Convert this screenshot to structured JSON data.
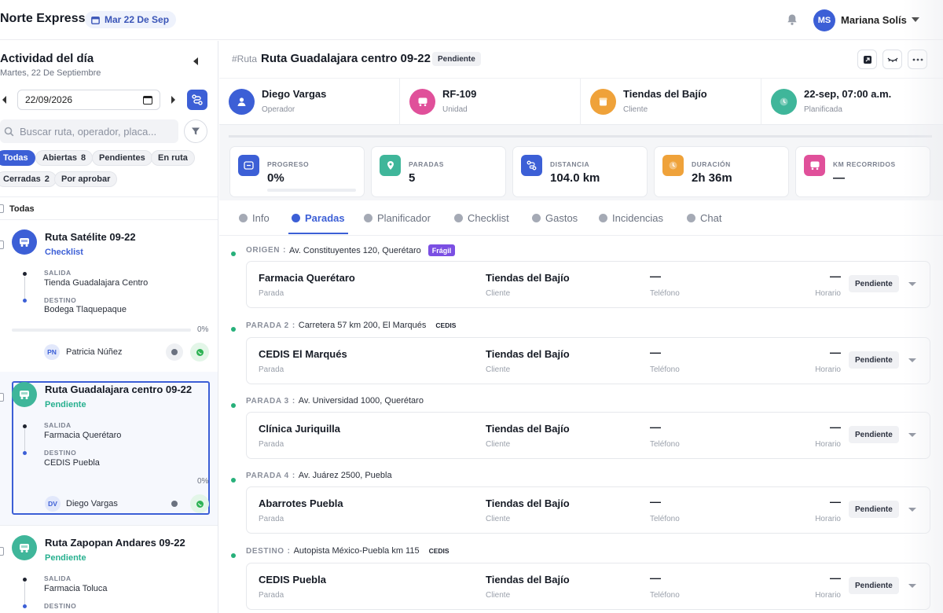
{
  "app": {
    "brand": "Norte Express",
    "date_chip": "Mar 22 De Sep"
  },
  "user": {
    "initials": "MS",
    "name": "Mariana Solís"
  },
  "sidebar": {
    "title": "Actividad del día",
    "subtitle": "Martes, 22 De Septiembre",
    "date_value": "22/09/2026",
    "search_placeholder": "Buscar ruta, operador, placa...",
    "filters": [
      {
        "label": "Todas",
        "count": ""
      },
      {
        "label": "Abiertas",
        "count": "8"
      },
      {
        "label": "Pendientes",
        "count": ""
      },
      {
        "label": "En ruta",
        "count": ""
      },
      {
        "label": "Cerradas",
        "count": "2"
      },
      {
        "label": "Por aprobar",
        "count": ""
      }
    ],
    "select_all_label": "Todas",
    "routes": [
      {
        "name": "Ruta Satélite 09-22",
        "status": "Checklist",
        "status_color": "#3c5fd6",
        "icon_color": "#3c5fd6",
        "salida_label": "SALIDA",
        "salida": "Tienda Guadalajara Centro",
        "destino_label": "DESTINO",
        "destino": "Bodega Tlaquepaque",
        "progress": "0%",
        "operator_initials": "PN",
        "operator": "Patricia Núñez"
      },
      {
        "name": "Ruta Guadalajara centro 09-22",
        "status": "Pendiente",
        "status_color": "#27b08f",
        "icon_color": "#3fb69a",
        "salida_label": "SALIDA",
        "salida": "Farmacia Querétaro",
        "destino_label": "DESTINO",
        "destino": "CEDIS Puebla",
        "progress": "0%",
        "operator_initials": "DV",
        "operator": "Diego Vargas"
      },
      {
        "name": "Ruta Zapopan Andares 09-22",
        "status": "Pendiente",
        "status_color": "#27b08f",
        "icon_color": "#3fb69a",
        "salida_label": "SALIDA",
        "salida": "Farmacia Toluca",
        "destino_label": "DESTINO"
      }
    ]
  },
  "main": {
    "hash": "#Ruta",
    "route_name": "Ruta Guadalajara centro 09-22",
    "route_status": "Pendiente",
    "info": [
      {
        "value": "Diego Vargas",
        "label": "Operador",
        "color": "#3c5fd6"
      },
      {
        "value": "RF-109",
        "label": "Unidad",
        "color": "#e0509a"
      },
      {
        "value": "Tiendas del Bajío",
        "label": "Cliente",
        "color": "#efa23a"
      },
      {
        "value": "22-sep, 07:00 a.m.",
        "label": "Planificada",
        "color": "#3fb69a"
      }
    ],
    "stats": [
      {
        "label": "PROGRESO",
        "value": "0%",
        "color": "#3c5fd6",
        "progress": 0
      },
      {
        "label": "PARADAS",
        "value": "5",
        "color": "#3fb69a"
      },
      {
        "label": "DISTANCIA",
        "value": "104.0 km",
        "color": "#3c5fd6"
      },
      {
        "label": "DURACIÓN",
        "value": "2h 36m",
        "color": "#efa23a"
      },
      {
        "label": "KM RECORRIDOS",
        "value": "—",
        "color": "#e0509a"
      }
    ],
    "tabs": [
      "Info",
      "Paradas",
      "Planificador",
      "Checklist",
      "Gastos",
      "Incidencias",
      "Chat"
    ],
    "active_tab": "Paradas",
    "stops": [
      {
        "kind": "ORIGEN",
        "sep": " :",
        "address": "Av. Constituyentes 120, Querétaro",
        "tag": "Frágil",
        "tag_type": "fragil",
        "name": "Farmacia Querétaro",
        "name_label": "Parada",
        "client": "Tiendas del Bajío",
        "client_label": "Cliente",
        "phone": "—",
        "phone_label": "Teléfono",
        "schedule": "—",
        "schedule_label": "Horario",
        "status": "Pendiente"
      },
      {
        "kind": "PARADA 2",
        "sep": " :",
        "address": "Carretera 57 km 200, El Marqués",
        "tag": "CEDIS",
        "tag_type": "cedis",
        "name": "CEDIS El Marqués",
        "name_label": "Parada",
        "client": "Tiendas del Bajío",
        "client_label": "Cliente",
        "phone": "—",
        "phone_label": "Teléfono",
        "schedule": "—",
        "schedule_label": "Horario",
        "status": "Pendiente"
      },
      {
        "kind": "PARADA 3",
        "sep": " :",
        "address": "Av. Universidad 1000, Querétaro",
        "tag": "",
        "tag_type": "",
        "name": "Clínica Juriquilla",
        "name_label": "Parada",
        "client": "Tiendas del Bajío",
        "client_label": "Cliente",
        "phone": "—",
        "phone_label": "Teléfono",
        "schedule": "—",
        "schedule_label": "Horario",
        "status": "Pendiente"
      },
      {
        "kind": "PARADA 4",
        "sep": " :",
        "address": "Av. Juárez 2500, Puebla",
        "tag": "",
        "tag_type": "",
        "name": "Abarrotes Puebla",
        "name_label": "Parada",
        "client": "Tiendas del Bajío",
        "client_label": "Cliente",
        "phone": "—",
        "phone_label": "Teléfono",
        "schedule": "—",
        "schedule_label": "Horario",
        "status": "Pendiente"
      },
      {
        "kind": "DESTINO",
        "sep": " :",
        "address": "Autopista México-Puebla km 115",
        "tag": "CEDIS",
        "tag_type": "cedis",
        "name": "CEDIS Puebla",
        "name_label": "Parada",
        "client": "Tiendas del Bajío",
        "client_label": "Cliente",
        "phone": "—",
        "phone_label": "Teléfono",
        "schedule": "—",
        "schedule_label": "Horario",
        "status": "Pendiente"
      }
    ]
  },
  "icons": [
    "calendar-icon",
    "bell-icon",
    "chevron-down-icon",
    "collapse-left-icon",
    "route-planner-icon",
    "search-icon",
    "filter-icon",
    "truck-icon",
    "chat-icon",
    "whatsapp-icon",
    "expand-icon",
    "eye-off-icon",
    "more-icon",
    "user-icon",
    "box-icon",
    "clock-icon"
  ]
}
